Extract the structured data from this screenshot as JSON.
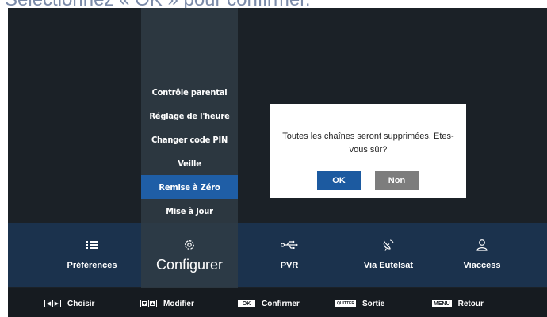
{
  "caption": "Sélectionnez « OK » pour confirmer.",
  "submenu": {
    "items": [
      {
        "label": "Contrôle parental",
        "active": false
      },
      {
        "label": "Réglage de l'heure",
        "active": false
      },
      {
        "label": "Changer code PIN",
        "active": false
      },
      {
        "label": "Veille",
        "active": false
      },
      {
        "label": "Remise à Zéro",
        "active": true
      },
      {
        "label": "Mise à Jour",
        "active": false
      }
    ]
  },
  "dialog": {
    "message": "Toutes les chaînes  seront supprimées. Etes-vous sûr?",
    "ok_label": "OK",
    "cancel_label": "Non"
  },
  "main_menu": {
    "items": [
      {
        "label": "Préférences",
        "icon": "list-icon"
      },
      {
        "label": "Configurer",
        "icon": "gear-icon",
        "active": true
      },
      {
        "label": "PVR",
        "icon": "usb-icon"
      },
      {
        "label": "Via Eutelsat",
        "icon": "satellite-dish-icon"
      },
      {
        "label": "Viaccess",
        "icon": "user-icon"
      }
    ]
  },
  "hints": {
    "choose": {
      "key": "◀ ▶",
      "label": "Choisir"
    },
    "modify": {
      "key": "▼ ▲",
      "label": "Modifier"
    },
    "confirm": {
      "key": "OK",
      "label": "Confirmer"
    },
    "exit": {
      "key": "QUITTER",
      "label": "Sortie"
    },
    "back": {
      "key": "MENU",
      "label": "Retour"
    }
  },
  "colors": {
    "highlight": "#1f5ea6",
    "main_bar": "#1b324d",
    "background": "#1b2127"
  }
}
